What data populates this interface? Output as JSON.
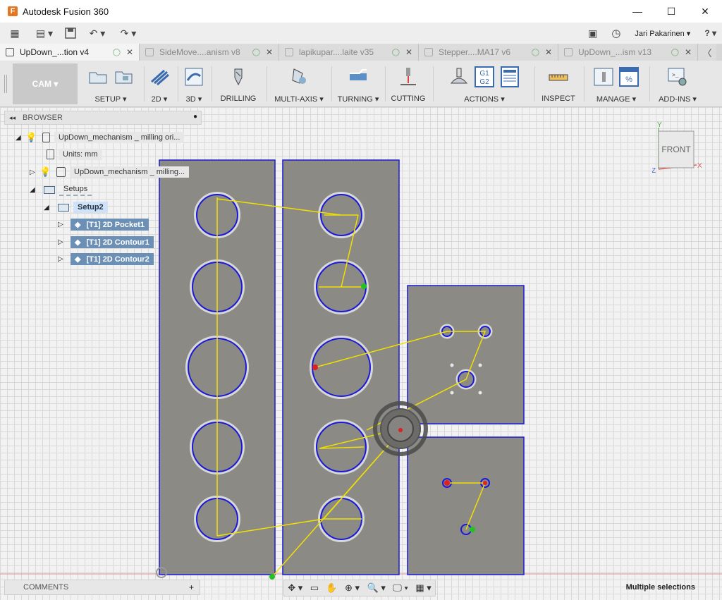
{
  "window": {
    "app_logo": "F",
    "title": "Autodesk Fusion 360",
    "minimize": "—",
    "maximize": "☐",
    "close": "✕"
  },
  "qat": {
    "grid_icon": "▦",
    "file_icon": "▤ ▾",
    "save_icon": "💾",
    "undo_icon": "↶ ▾",
    "redo_icon": "↷ ▾",
    "user": "Jari Pakarinen ▾",
    "help": "? ▾",
    "comment_icon": "▣",
    "clock_icon": "◷"
  },
  "tabs": [
    {
      "label": "UpDown_...tion v4",
      "active": true
    },
    {
      "label": "SideMove....anism v8",
      "active": false
    },
    {
      "label": "lapikupar....laite v35",
      "active": false
    },
    {
      "label": "Stepper....MA17 v6",
      "active": false
    },
    {
      "label": "UpDown_...ism v13",
      "active": false
    }
  ],
  "tab_close": "✕",
  "tab_cloud": "◯",
  "tabs_chevron": "〈",
  "ribbon": {
    "workspace": "CAM ▾",
    "groups": [
      "SETUP ▾",
      "2D ▾",
      "3D ▾",
      "DRILLING",
      "MULTI-AXIS ▾",
      "TURNING ▾",
      "CUTTING",
      "ACTIONS ▾",
      "INSPECT",
      "MANAGE ▾",
      "ADD-INS ▾"
    ],
    "g1g2": [
      "G1",
      "G2"
    ]
  },
  "browser": {
    "title": "BROWSER",
    "collapse": "◂◂",
    "close": "●",
    "root": "UpDown_mechanism _ milling ori...",
    "units": "Units: mm",
    "component": "UpDown_mechanism _ milling...",
    "setups": "Setups",
    "setup2": "Setup2",
    "operations": [
      "[T1] 2D Pocket1",
      "[T1] 2D Contour1",
      "[T1] 2D Contour2"
    ]
  },
  "viewcube": {
    "face": "FRONT",
    "y": "Y",
    "x": "X",
    "z": "Z"
  },
  "comments": {
    "label": "COMMENTS",
    "add": "+"
  },
  "nav": {
    "orbit": "✥ ▾",
    "look": "▭",
    "pan": "✋",
    "zoom": "⊕ ▾",
    "fit": "🔍 ▾",
    "display": "🖵 ▾",
    "grid": "▦ ▾"
  },
  "status": "Multiple selections",
  "colors": {
    "stock": "#8c8a85",
    "outline": "#1a1ad6",
    "toolpath": "#f0e000",
    "accent": "#e8761e"
  }
}
